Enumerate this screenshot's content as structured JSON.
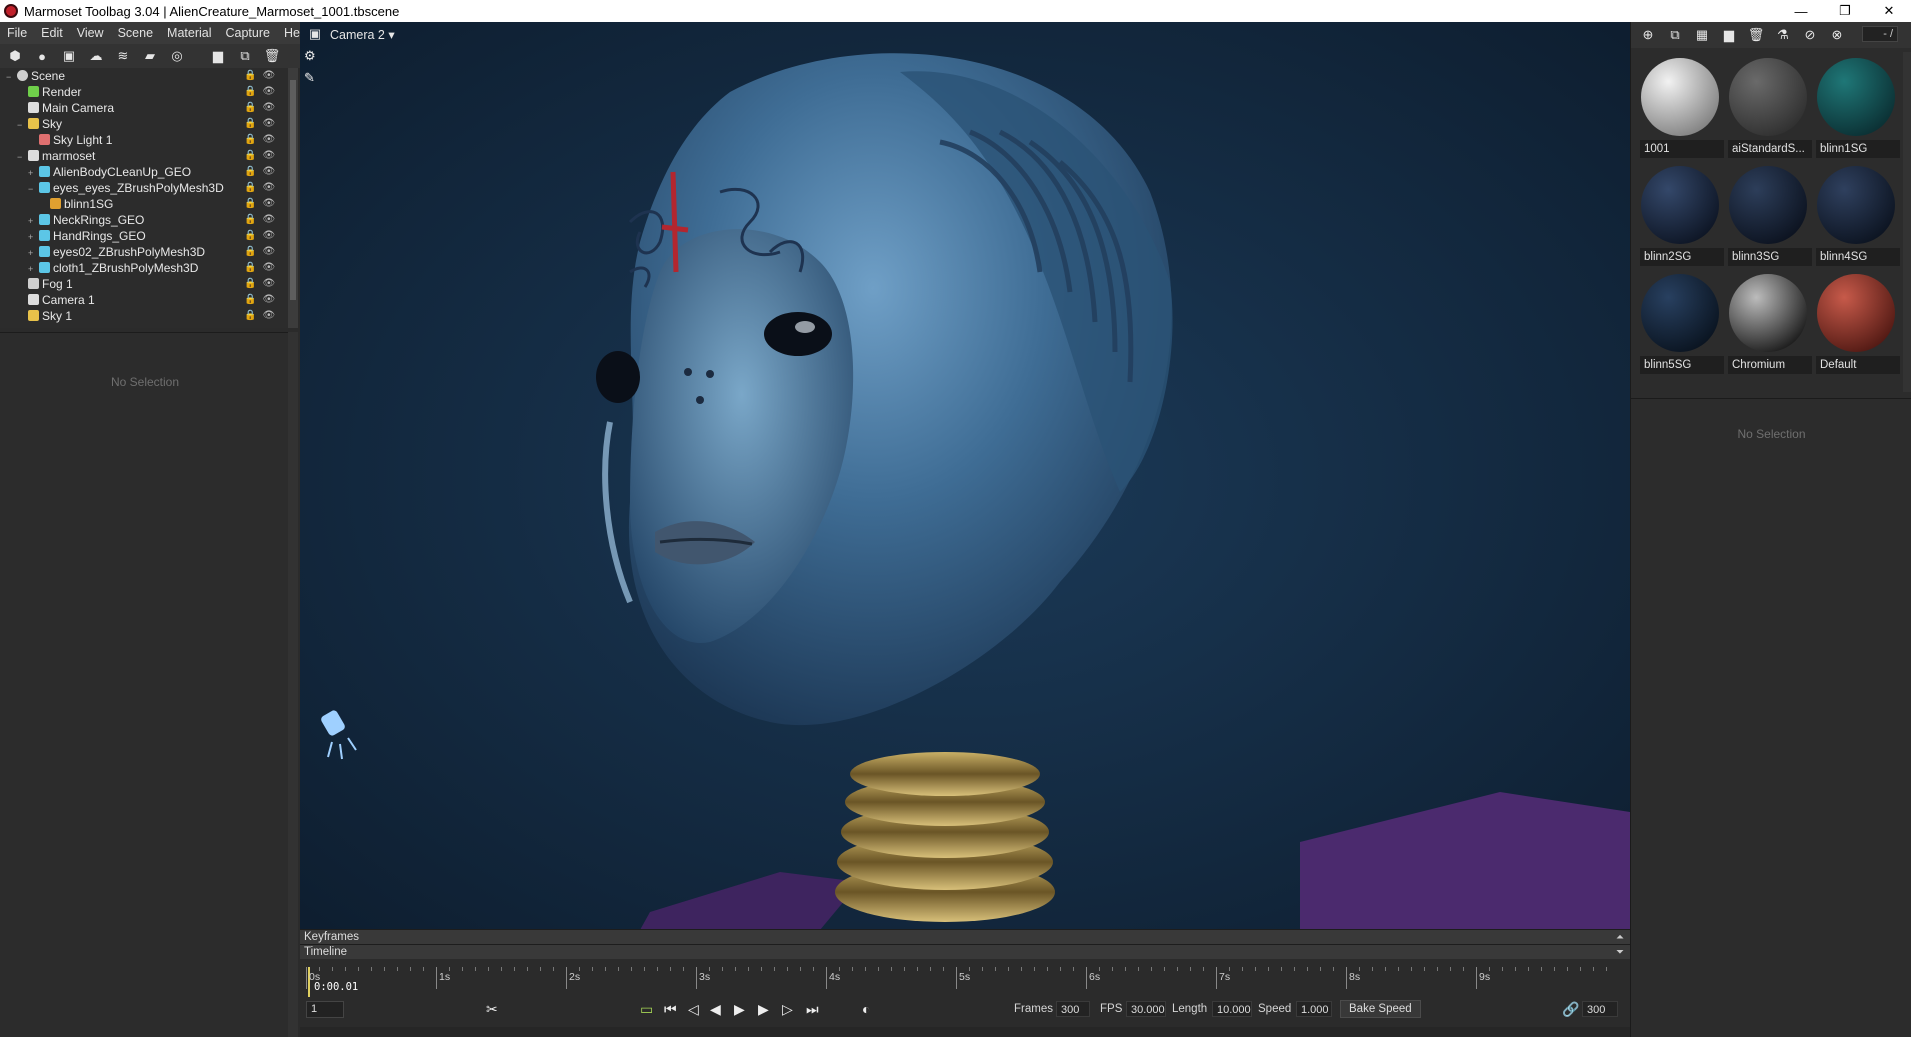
{
  "window": {
    "title": "Marmoset Toolbag 3.04  |  AlienCreature_Marmoset_1001.tbscene",
    "controls": [
      "—",
      "❐",
      "✕"
    ]
  },
  "menu": [
    "File",
    "Edit",
    "View",
    "Scene",
    "Material",
    "Capture",
    "Help"
  ],
  "scene_tree": {
    "items": [
      {
        "label": "Scene",
        "icon": "scene-icon",
        "indent": 0,
        "expander": "−"
      },
      {
        "label": "Render",
        "icon": "render-icon",
        "indent": 1,
        "expander": ""
      },
      {
        "label": "Main Camera",
        "icon": "camera-icon",
        "indent": 1,
        "expander": ""
      },
      {
        "label": "Sky",
        "icon": "sky-icon",
        "indent": 1,
        "expander": "−"
      },
      {
        "label": "Sky Light 1",
        "icon": "light-icon",
        "indent": 2,
        "expander": ""
      },
      {
        "label": "marmoset",
        "icon": "group-icon",
        "indent": 1,
        "expander": "−"
      },
      {
        "label": "AlienBodyCLeanUp_GEO",
        "icon": "mesh-icon",
        "indent": 2,
        "expander": "+"
      },
      {
        "label": "eyes_eyes_ZBrushPolyMesh3D",
        "icon": "mesh-icon",
        "indent": 2,
        "expander": "−"
      },
      {
        "label": "blinn1SG",
        "icon": "material-icon",
        "indent": 3,
        "expander": ""
      },
      {
        "label": "NeckRings_GEO",
        "icon": "mesh-icon",
        "indent": 2,
        "expander": "+"
      },
      {
        "label": "HandRings_GEO",
        "icon": "mesh-icon",
        "indent": 2,
        "expander": "+"
      },
      {
        "label": "eyes02_ZBrushPolyMesh3D",
        "icon": "mesh-icon",
        "indent": 2,
        "expander": "+"
      },
      {
        "label": "cloth1_ZBrushPolyMesh3D",
        "icon": "mesh-icon",
        "indent": 2,
        "expander": "+"
      },
      {
        "label": "Fog 1",
        "icon": "fog-icon",
        "indent": 1,
        "expander": ""
      },
      {
        "label": "Camera 1",
        "icon": "camera-icon",
        "indent": 1,
        "expander": ""
      },
      {
        "label": "Sky 1",
        "icon": "sky-icon",
        "indent": 1,
        "expander": ""
      }
    ]
  },
  "left_properties": {
    "empty_text": "No Selection"
  },
  "viewport": {
    "camera_label": "Camera 2 ▾"
  },
  "panels": {
    "keyframes": "Keyframes",
    "timeline": "Timeline"
  },
  "timeline": {
    "ticks": [
      "0s",
      "1s",
      "2s",
      "3s",
      "4s",
      "5s",
      "6s",
      "7s",
      "8s",
      "9s"
    ],
    "current_time": "0:00.01",
    "current_frame": "1",
    "frames_label": "Frames",
    "frames": "300",
    "fps_label": "FPS",
    "fps": "30.000",
    "length_label": "Length",
    "length": "10.000",
    "speed_label": "Speed",
    "speed": "1.000",
    "bake_speed": "Bake Speed",
    "end_frame": "300"
  },
  "materials": {
    "zoom_field": "- /",
    "items": [
      {
        "label": "1001",
        "color_a": "#f2f2f2",
        "color_b": "#7a7a7a"
      },
      {
        "label": "aiStandardS...",
        "color_a": "#6a6a6a",
        "color_b": "#2c2c2c"
      },
      {
        "label": "blinn1SG",
        "color_a": "#1f7777",
        "color_b": "#0a2b2f"
      },
      {
        "label": "blinn2SG",
        "color_a": "#34486a",
        "color_b": "#0b1220"
      },
      {
        "label": "blinn3SG",
        "color_a": "#2d3e5a",
        "color_b": "#0a101c"
      },
      {
        "label": "blinn4SG",
        "color_a": "#2f405e",
        "color_b": "#0a111d"
      },
      {
        "label": "blinn5SG",
        "color_a": "#284060",
        "color_b": "#08111c"
      },
      {
        "label": "Chromium",
        "color_a": "#bcbcbc",
        "color_b": "#111111"
      },
      {
        "label": "Default",
        "color_a": "#c75a4a",
        "color_b": "#4a1510"
      }
    ]
  },
  "right_properties": {
    "empty_text": "No Selection"
  }
}
